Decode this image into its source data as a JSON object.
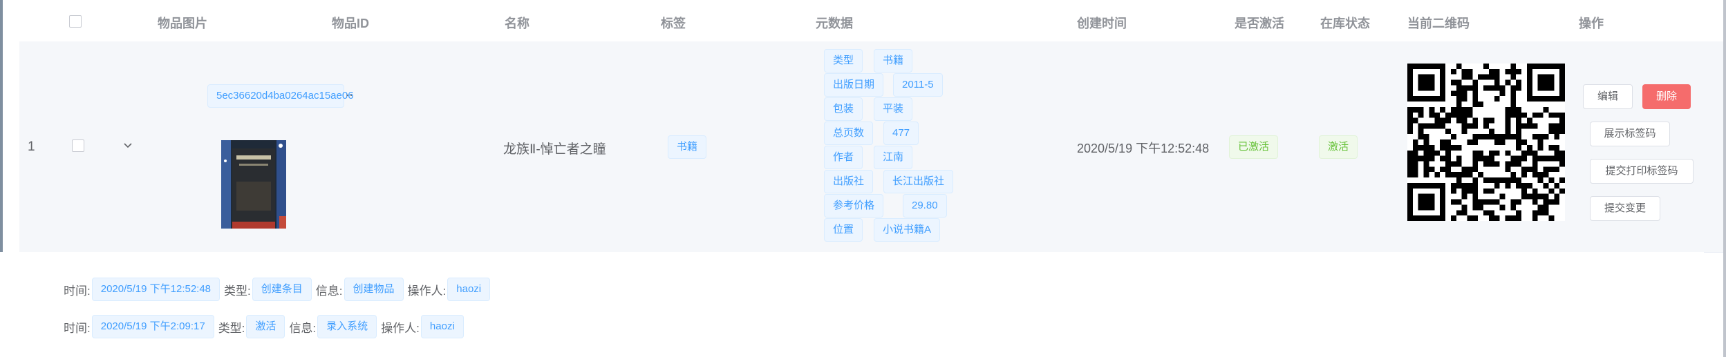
{
  "table": {
    "headers": {
      "image": "物品图片",
      "id": "物品ID",
      "name": "名称",
      "tag": "标签",
      "metadata": "元数据",
      "created": "创建时间",
      "activated": "是否激活",
      "stock": "在库状态",
      "qrcode": "当前二维码",
      "actions": "操作"
    },
    "row": {
      "index": "1",
      "item_id": "5ec36620d4ba0264ac15ae06",
      "item_id_overflow": "‥",
      "name": "龙族Ⅱ-悼亡者之瞳",
      "tag": "书籍",
      "metadata": [
        {
          "key": "类型",
          "value": "书籍"
        },
        {
          "key": "出版日期",
          "value": "2011-5"
        },
        {
          "key": "包装",
          "value": "平装"
        },
        {
          "key": "总页数",
          "value": "477"
        },
        {
          "key": "作者",
          "value": "江南"
        },
        {
          "key": "出版社",
          "value": "长江出版社"
        },
        {
          "key": "参考价格",
          "value": "29.80"
        },
        {
          "key": "位置",
          "value": "小说书籍A"
        }
      ],
      "created_time": "2020/5/19 下午12:52:48",
      "activated": "已激活",
      "stock_status": "激活",
      "actions": {
        "edit": "编辑",
        "delete": "删除",
        "show_label": "展示标签码",
        "submit_print": "提交打印标签码",
        "submit_change": "提交变更"
      }
    }
  },
  "history": {
    "labels": {
      "time": "时间:",
      "type": "类型:",
      "info": "信息:",
      "operator": "操作人:"
    },
    "entries": [
      {
        "time": "2020/5/19 下午12:52:48",
        "type": "创建条目",
        "info": "创建物品",
        "operator": "haozi"
      },
      {
        "time": "2020/5/19 下午2:09:17",
        "type": "激活",
        "info": "录入系统",
        "operator": "haozi"
      }
    ]
  },
  "colors": {
    "primary": "#409eff",
    "danger": "#f56c6c",
    "success": "#67c23a"
  }
}
